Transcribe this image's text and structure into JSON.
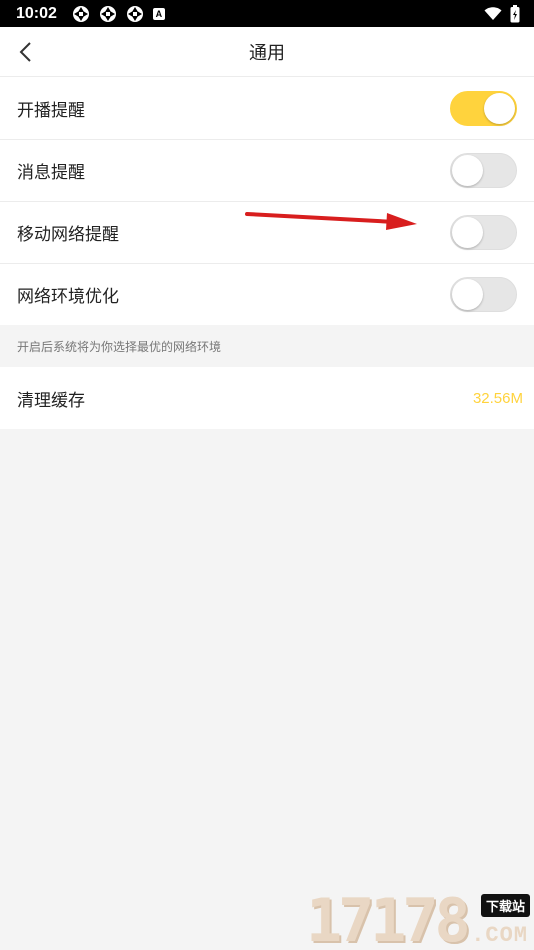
{
  "statusbar": {
    "time": "10:02"
  },
  "header": {
    "title": "通用"
  },
  "settings": {
    "items": [
      {
        "label": "开播提醒",
        "on": true
      },
      {
        "label": "消息提醒",
        "on": false
      },
      {
        "label": "移动网络提醒",
        "on": false
      },
      {
        "label": "网络环境优化",
        "on": false
      }
    ],
    "hint": "开启后系统将为你选择最优的网络环境"
  },
  "cache": {
    "label": "清理缓存",
    "value": "32.56M"
  },
  "watermark": {
    "number": "17178",
    "badge": "下载站",
    "suffix": ".COM"
  },
  "colors": {
    "accent": "#ffd33d",
    "annotation_arrow": "#d81e1e"
  }
}
